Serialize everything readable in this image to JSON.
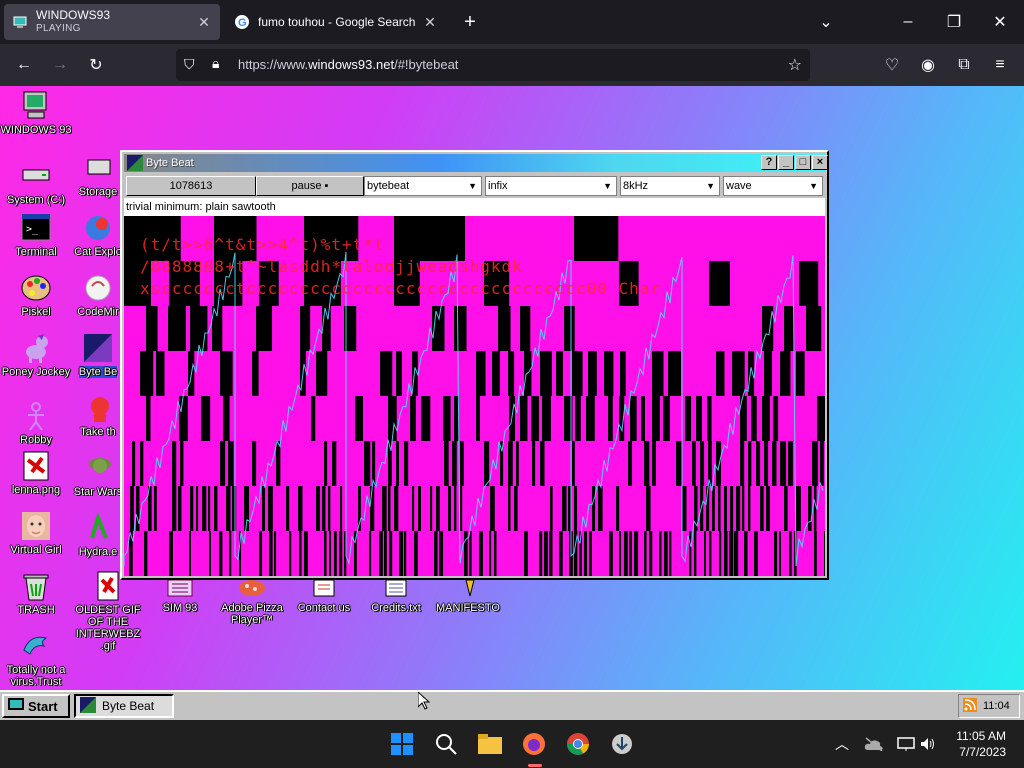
{
  "browser": {
    "tabs": [
      {
        "title": "WINDOWS93",
        "subtitle": "PLAYING"
      },
      {
        "title": "fumo touhou - Google Search"
      }
    ],
    "url_prefix": "https://www.",
    "url_domain": "windows93.net",
    "url_suffix": "/#!bytebeat"
  },
  "desktop": {
    "icons_col1": [
      {
        "label": "WINDOWS 93",
        "icon": "computer-icon"
      },
      {
        "label": "System (C:)",
        "icon": "drive-icon"
      },
      {
        "label": "Terminal",
        "icon": "terminal-icon"
      },
      {
        "label": "Piskel",
        "icon": "palette-icon"
      },
      {
        "label": "Poney Jockey",
        "icon": "pony-icon"
      },
      {
        "label": "Robby",
        "icon": "stickman-icon"
      },
      {
        "label": "lenna.png",
        "icon": "image-icon"
      },
      {
        "label": "Virtual Girl",
        "icon": "face-icon"
      },
      {
        "label": "TRASH",
        "icon": "trash-icon"
      },
      {
        "label": "Totally not a virus.Trust",
        "icon": "dolphin-icon"
      }
    ],
    "icons_col2": [
      {
        "label": "Storage",
        "icon": "storage-icon"
      },
      {
        "label": "Cat Explo",
        "icon": "cat-explorer-icon"
      },
      {
        "label": "CodeMir",
        "icon": "codemirror-icon"
      },
      {
        "label": "Byte Be",
        "icon": "bytebeat-icon"
      },
      {
        "label": "Take th",
        "icon": "take-icon"
      },
      {
        "label": "Star Wars",
        "icon": "yoda-icon"
      },
      {
        "label": "Hydra.e",
        "icon": "hydra-icon"
      },
      {
        "label": "OLDEST GIF OF THE INTERWEBZ .gif",
        "icon": "gif-icon"
      }
    ],
    "icons_row": [
      {
        "label": "SIM 93",
        "icon": "sim-icon"
      },
      {
        "label": "Adobe Pizza Player™",
        "icon": "pizza-icon"
      },
      {
        "label": "Contact us",
        "icon": "contact-icon"
      },
      {
        "label": "Credits.txt",
        "icon": "text-file-icon"
      },
      {
        "label": "MANIFESTO",
        "icon": "manifesto-icon"
      }
    ]
  },
  "window": {
    "title": "Byte Beat",
    "buttons": [
      "?",
      "_",
      "□",
      "×"
    ],
    "counter": "1078613",
    "pause_label": "pause ▪",
    "selects": [
      "bytebeat",
      "infix",
      "8kHz",
      "wave"
    ],
    "description": "trivial minimum: plain sawtooth",
    "code_lines": [
      "(t/t>>6^t&t>>4^t)%t+t*t",
      "/8888888+t^~lasddh*talodjjweadshgkdk",
      "xsccccccctcccccccccccccccccccccccccccccccc00 Char"
    ]
  },
  "taskbar": {
    "start_label": "Start",
    "task_label": "Byte Beat",
    "tray_time": "11:04"
  },
  "os_taskbar": {
    "time": "11:05 AM",
    "date": "7/7/2023"
  }
}
